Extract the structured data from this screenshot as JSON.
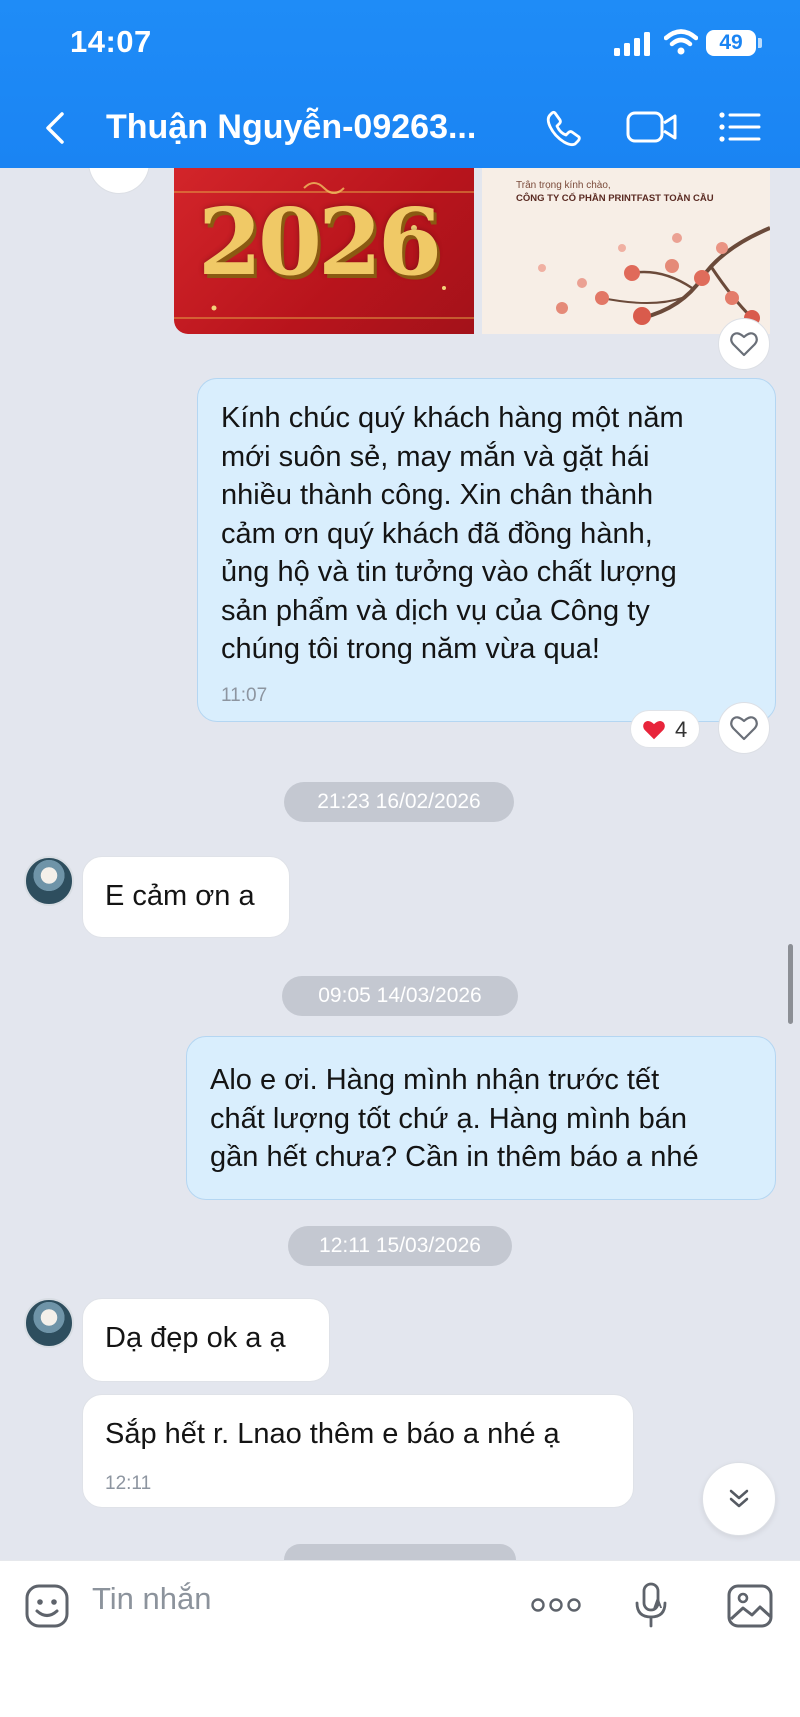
{
  "status_bar": {
    "time": "14:07",
    "battery": "49"
  },
  "header": {
    "contact_name": "Thuận Nguyễn-09263..."
  },
  "cards": {
    "card1_text": "2026",
    "card2_greeting": "Trân trọng kính chào,",
    "card2_company": "CÔNG TY CỔ PHẦN PRINTFAST TOÀN CẦU"
  },
  "messages": {
    "greeting": {
      "text": "Kính chúc quý khách hàng một năm\nmới suôn sẻ, may mắn và gặt hái\nnhiều thành công. Xin chân thành\ncảm ơn quý khách đã đồng hành,\nủng hộ và tin tưởng vào chất lượng\nsản phẩm và dịch vụ của Công ty\nchúng tôi trong năm vừa qua!",
      "time": "11:07",
      "reaction_count": "4"
    },
    "date1": "21:23 16/02/2026",
    "thanks": {
      "text": "E cảm ơn a"
    },
    "date2": "09:05 14/03/2026",
    "question": {
      "text": "Alo e ơi. Hàng mình nhận trước tết\nchất lượng tốt chứ ạ. Hàng mình bán\ngần hết chưa? Cần in thêm báo a nhé"
    },
    "date3": "12:11 15/03/2026",
    "reply1": {
      "text": "Dạ đẹp ok a ạ"
    },
    "reply2": {
      "text": "Sắp hết r. Lnao thêm e báo a nhé ạ",
      "time": "12:11"
    }
  },
  "input": {
    "placeholder": "Tin nhắn"
  },
  "icons": {
    "back": "back-chevron-icon",
    "call": "phone-icon",
    "video": "video-camera-icon",
    "menu": "list-menu-icon",
    "like": "heart-outline-icon",
    "reaction": "heart-filled-icon",
    "scroll_down": "double-chevron-down-icon",
    "sticker": "sticker-icon",
    "more": "more-dots-icon",
    "voice": "voice-to-text-icon",
    "gallery": "image-gallery-icon"
  },
  "colors": {
    "header": "#1a84f3",
    "outgoing_bubble": "#d9eefd",
    "incoming_bubble": "#ffffff",
    "chat_background": "#e3e6ee",
    "reaction_heart": "#e8253b"
  }
}
